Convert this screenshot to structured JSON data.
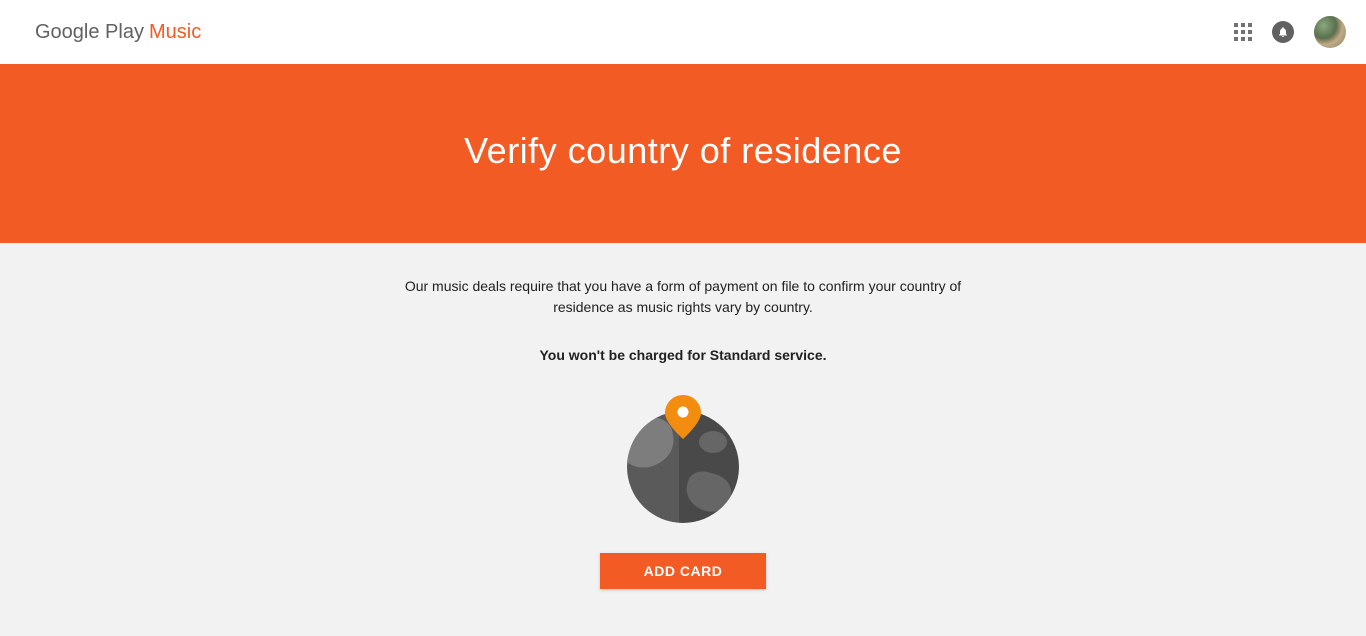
{
  "header": {
    "logo_part1": "Google Play",
    "logo_part2": "Music"
  },
  "hero": {
    "title": "Verify country of residence"
  },
  "content": {
    "description": "Our music deals require that you have a form of payment on file to confirm your country of residence as music rights vary by country.",
    "emphasis": "You won't be charged for Standard service.",
    "button_label": "ADD CARD"
  },
  "colors": {
    "accent": "#f25b24",
    "pin": "#f28d0f"
  }
}
